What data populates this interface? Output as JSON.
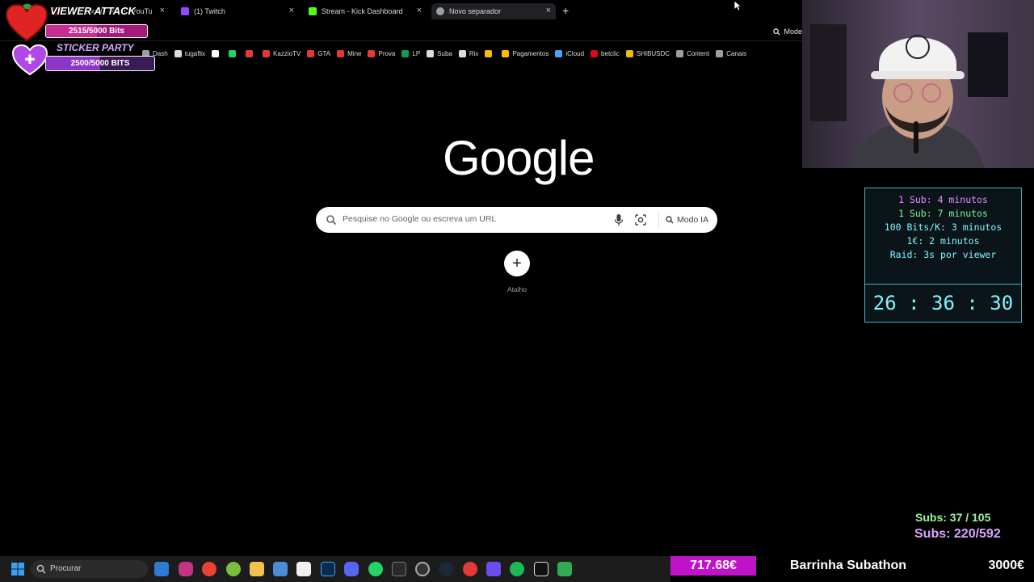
{
  "browser": {
    "tabs": [
      {
        "label": "Conteúdo do canal - YouTube S",
        "favicon_color": "#ff0000",
        "active": false
      },
      {
        "label": "(1) Twitch",
        "favicon_color": "#9146ff",
        "active": false
      },
      {
        "label": "Stream - Kick Dashboard",
        "favicon_color": "#53fc18",
        "active": false
      },
      {
        "label": "Novo separador",
        "favicon_color": "#9aa0a6",
        "active": true
      }
    ],
    "new_tab_symbol": "+",
    "close_symbol": "×",
    "omnibox_mode_label": "Mode"
  },
  "bookmarks": [
    {
      "label": "Dash",
      "icon_color": "#9aa0a6"
    },
    {
      "label": "tugaflix",
      "icon_color": "#dadce0"
    },
    {
      "label": "",
      "icon": "x-icon",
      "icon_color": "#ffffff"
    },
    {
      "label": "",
      "icon": "whatsapp-icon",
      "icon_color": "#25d366"
    },
    {
      "label": "",
      "icon": "chart-icon",
      "icon_color": "#e53935"
    },
    {
      "label": "KazzioTV",
      "icon_color": "#e53935"
    },
    {
      "label": "GTA",
      "icon_color": "#e53935"
    },
    {
      "label": "Mine",
      "icon_color": "#e53935"
    },
    {
      "label": "Prova",
      "icon_color": "#e53935"
    },
    {
      "label": "LP",
      "icon_color": "#0f9d58"
    },
    {
      "label": "Suba",
      "icon_color": "#dadce0"
    },
    {
      "label": "Rix",
      "icon_color": "#dadce0"
    },
    {
      "label": "",
      "icon": "drive-icon",
      "icon_color": "#fbbc04"
    },
    {
      "label": "Pagamentos",
      "icon_color": "#fbbc04"
    },
    {
      "label": "iCloud",
      "icon_color": "#4fa3f7"
    },
    {
      "label": "betclic",
      "icon_color": "#e30613"
    },
    {
      "label": "SHIBUSDC",
      "icon_color": "#f0b90b"
    },
    {
      "label": "Content",
      "icon_color": "#9aa0a6"
    },
    {
      "label": "Canais",
      "icon_color": "#9aa0a6"
    }
  ],
  "newtab": {
    "logo_text": "Google",
    "search_placeholder": "Pesquise no Google ou escreva um URL",
    "ai_mode_label": "Modo IA",
    "shortcut_symbol": "+",
    "shortcut_label": "Atalho"
  },
  "overlay": {
    "goal1": {
      "title": "VIEWER ATTACK",
      "progress_text": "2515/5000 Bits",
      "current": 2515,
      "target": 5000,
      "color": "#c52d92"
    },
    "goal2": {
      "title": "STICKER PARTY",
      "progress_text": "2500/5000 BITS",
      "current": 2500,
      "target": 5000,
      "color": "#8b35c9"
    },
    "subathon_rules": [
      {
        "text": "1 Sub: 4 minutos",
        "color": "#e28cff"
      },
      {
        "text": "1 Sub: 7 minutos",
        "color": "#7ff5a0"
      },
      {
        "text": "100 Bits/K: 3 minutos",
        "color": "#7ff5ff"
      },
      {
        "text": "1€: 2 minutos",
        "color": "#7ff5ff"
      },
      {
        "text": "Raid: 3s por viewer",
        "color": "#7ff5ff"
      }
    ],
    "timer": "26 : 36 : 30",
    "subs_line1": "Subs: 37 / 105",
    "subs_line2": "Subs: 220/592",
    "donation_amount": "717.68€",
    "donation_title": "Barrinha Subathon",
    "donation_goal": "3000€"
  },
  "taskbar": {
    "search_label": "Procurar"
  }
}
